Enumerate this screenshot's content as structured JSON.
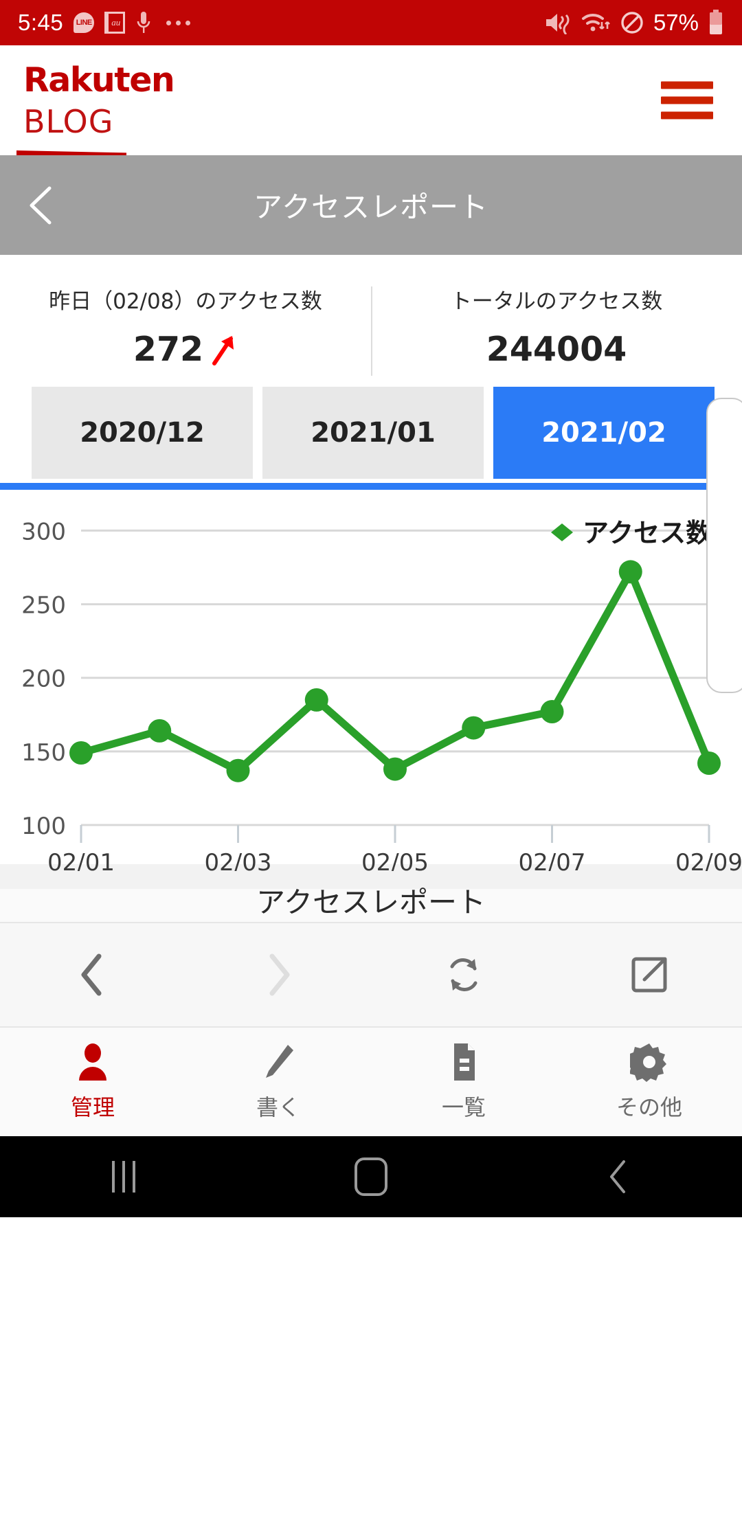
{
  "status_bar": {
    "time": "5:45",
    "battery_percent": "57%",
    "icons": [
      "line-icon",
      "au-icon",
      "microphone-icon",
      "more-dots-icon",
      "vibrate-mute-icon",
      "wifi-icon",
      "do-not-disturb-icon",
      "battery-icon"
    ],
    "background_color": "#c00505"
  },
  "site_header": {
    "brand": "Rakuten",
    "sub_brand": "BLOG",
    "brand_color": "#bf0000",
    "menu_icon": "hamburger-icon"
  },
  "page_header": {
    "title": "アクセスレポート",
    "back_icon": "chevron-left-icon",
    "background_color": "#a0a0a0"
  },
  "stats": [
    {
      "label": "昨日（02/08）のアクセス数",
      "value": "272",
      "trend": "up",
      "trend_color": "#ff0000"
    },
    {
      "label": "トータルのアクセス数",
      "value": "244004",
      "trend": "none"
    }
  ],
  "month_tabs": {
    "items": [
      {
        "label": "2020/12",
        "active": false
      },
      {
        "label": "2021/01",
        "active": false
      },
      {
        "label": "2021/02",
        "active": true
      }
    ],
    "active_color": "#2b7bf6",
    "inactive_color": "#e8e8e8"
  },
  "chart_data": {
    "type": "line",
    "title": "アクセスレポート",
    "xlabel": "",
    "ylabel": "",
    "ylim": [
      100,
      310
    ],
    "yticks": [
      100,
      150,
      200,
      250,
      300
    ],
    "grid": true,
    "legend_position": "top-right",
    "series_color": "#2aa02a",
    "x": [
      "02/01",
      "02/02",
      "02/03",
      "02/04",
      "02/05",
      "02/06",
      "02/07",
      "02/08",
      "02/09"
    ],
    "xtick_labels": [
      "02/01",
      "02/03",
      "02/05",
      "02/07",
      "02/09"
    ],
    "series": [
      {
        "name": "アクセス数",
        "values": [
          149,
          164,
          137,
          185,
          138,
          166,
          177,
          272,
          142
        ]
      }
    ]
  },
  "browser_toolbar": {
    "buttons": [
      {
        "icon": "chevron-left-icon",
        "name": "back",
        "enabled": true
      },
      {
        "icon": "chevron-right-icon",
        "name": "forward",
        "enabled": false
      },
      {
        "icon": "refresh-icon",
        "name": "reload",
        "enabled": true
      },
      {
        "icon": "open-external-icon",
        "name": "open-in-browser",
        "enabled": true
      }
    ]
  },
  "tab_bar": {
    "items": [
      {
        "label": "管理",
        "icon": "person-icon",
        "active": true
      },
      {
        "label": "書く",
        "icon": "pencil-icon",
        "active": false
      },
      {
        "label": "一覧",
        "icon": "document-icon",
        "active": false
      },
      {
        "label": "その他",
        "icon": "gear-icon",
        "active": false
      }
    ],
    "active_color": "#c00000",
    "inactive_color": "#6b6b6b"
  },
  "android_nav": {
    "buttons": [
      {
        "icon": "recents-icon",
        "name": "recent-apps"
      },
      {
        "icon": "home-icon",
        "name": "home"
      },
      {
        "icon": "back-icon",
        "name": "back"
      }
    ]
  }
}
